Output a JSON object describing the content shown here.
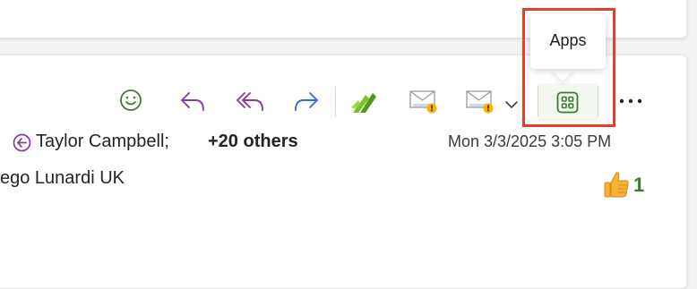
{
  "toolbar": {
    "tooltip": "Apps",
    "more_label": "···"
  },
  "message": {
    "sender": "Taylor Campbell;",
    "others": "+20 others",
    "date": "Mon 3/3/2025 3:05 PM",
    "recipient": "ego Lunardi UK",
    "reaction_count": "1"
  },
  "colors": {
    "highlight": "#e53f2c",
    "green_accent": "#3f7a34",
    "reply_purple": "#8a3b9e",
    "forward_blue": "#2f6fd8"
  }
}
